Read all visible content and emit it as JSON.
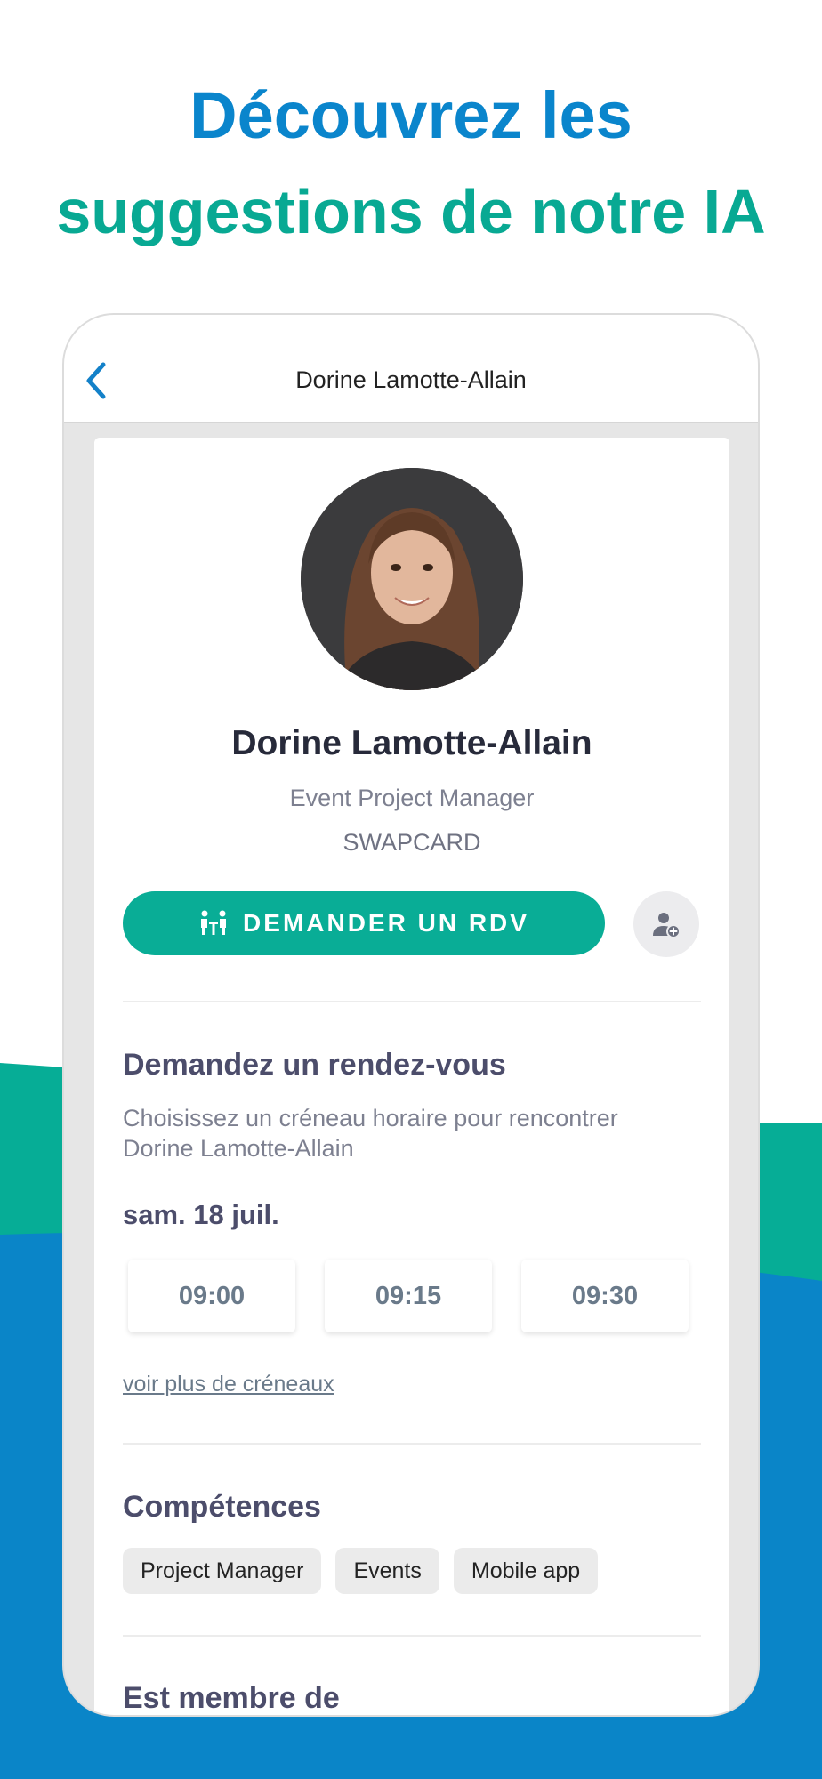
{
  "colors": {
    "headline_blue": "#0a85cc",
    "headline_teal": "#08a993",
    "cta_teal": "#09ad96",
    "wave_teal": "#06ad96",
    "wave_blue": "#0a85c8"
  },
  "headline": {
    "line1": "Découvrez les",
    "line2": "suggestions de notre IA"
  },
  "topbar": {
    "back_icon": "chevron-left-icon",
    "title": "Dorine Lamotte-Allain"
  },
  "profile": {
    "avatar_alt": "profile-photo",
    "name": "Dorine Lamotte-Allain",
    "job_title": "Event Project Manager",
    "company": "SWAPCARD"
  },
  "actions": {
    "meeting_icon": "meeting-icon",
    "meeting_label": "DEMANDER UN RDV",
    "add_contact_icon": "add-contact-icon"
  },
  "meeting": {
    "title": "Demandez un rendez-vous",
    "description": "Choisissez un créneau horaire pour rencontrer Dorine Lamotte-Allain",
    "date": "sam. 18 juil.",
    "slots": [
      "09:00",
      "09:15",
      "09:30"
    ],
    "more_link": "voir plus de créneaux"
  },
  "skills": {
    "title": "Compétences",
    "tags": [
      "Project Manager",
      "Events",
      "Mobile app"
    ]
  },
  "membership": {
    "title": "Est membre de"
  }
}
